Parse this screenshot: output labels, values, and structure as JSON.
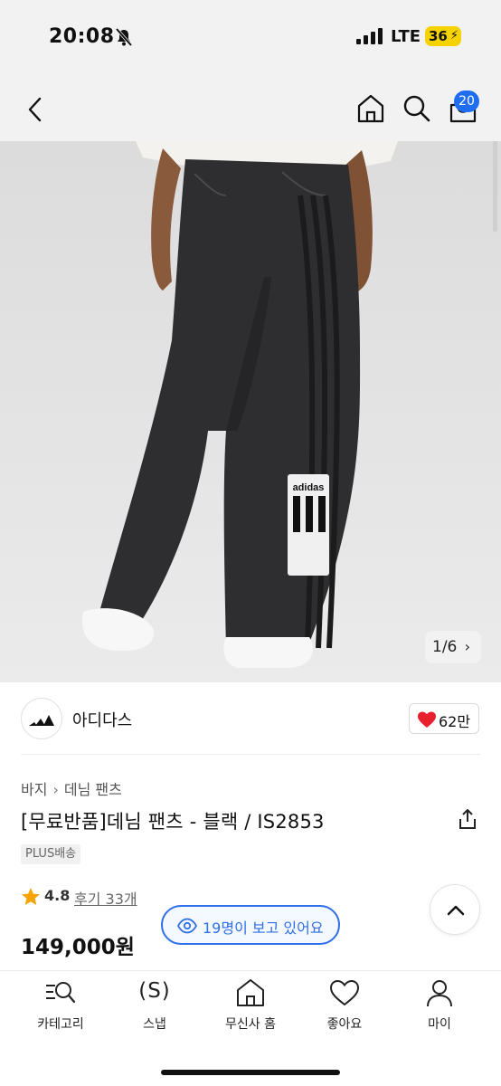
{
  "status_bar": {
    "time": "20:08",
    "network": "LTE",
    "battery": "36"
  },
  "header": {
    "cart_count": "20"
  },
  "image": {
    "counter": "1/6",
    "patch_text": "adidas"
  },
  "brand": {
    "name": "아디다스",
    "likes": "62만"
  },
  "breadcrumb": [
    "바지",
    "데님 팬츠"
  ],
  "product": {
    "title": "[무료반품]데님 팬츠 - 블랙 / IS2853",
    "shipping": "PLUS배송",
    "rating": "4.8",
    "reviews": "후기 33개",
    "price": "149,000원",
    "viewers": "19명이 보고 있어요"
  },
  "nav": {
    "items": [
      {
        "label": "카테고리",
        "icon": "category-search-icon"
      },
      {
        "label": "스냅",
        "icon": "snap-icon",
        "glyph": "(S)"
      },
      {
        "label": "무신사 홈",
        "icon": "home-icon"
      },
      {
        "label": "좋아요",
        "icon": "heart-icon"
      },
      {
        "label": "마이",
        "icon": "person-icon"
      }
    ]
  },
  "colors": {
    "accent_blue": "#2f6fe8",
    "badge_blue": "#1f6df2",
    "heart_red": "#e8202d",
    "star_orange": "#f5a400",
    "battery_yellow": "#f5d200"
  }
}
